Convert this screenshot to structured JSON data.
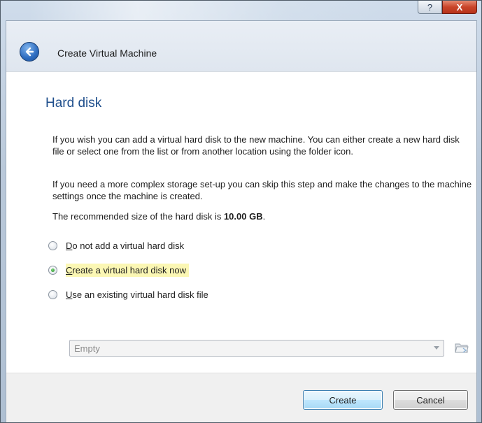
{
  "window": {
    "title": "Create Virtual Machine",
    "help_glyph": "?",
    "close_glyph": "X"
  },
  "page": {
    "heading": "Hard disk",
    "paragraph1": "If you wish you can add a virtual hard disk to the new machine. You can either create a new hard disk file or select one from the list or from another location using the folder icon.",
    "paragraph2": "If you need a more complex storage set-up you can skip this step and make the changes to the machine settings once the machine is created.",
    "recommend_prefix": "The recommended size of the hard disk is ",
    "recommend_value": "10.00 GB",
    "recommend_suffix": "."
  },
  "options": [
    {
      "mnemonic": "D",
      "rest": "o not add a virtual hard disk",
      "selected": false
    },
    {
      "mnemonic": "C",
      "rest": "reate a virtual hard disk now",
      "selected": true
    },
    {
      "mnemonic": "U",
      "rest": "se an existing virtual hard disk file",
      "selected": false
    }
  ],
  "disk_select": {
    "value": "Empty",
    "enabled": false
  },
  "footer": {
    "create_label": "Create",
    "cancel_label": "Cancel"
  },
  "colors": {
    "heading": "#1e4e8c",
    "highlight": "#fbf7b4",
    "close_button": "#c9452a"
  }
}
